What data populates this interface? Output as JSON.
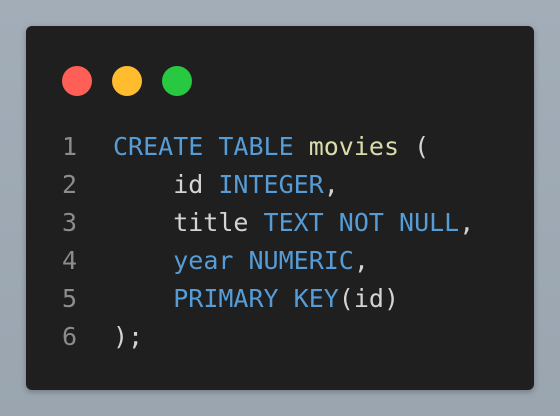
{
  "colors": {
    "background": "#9fa9b4",
    "window": "#1f1f1f",
    "dot_red": "#ff5f57",
    "dot_yellow": "#febc2e",
    "dot_green": "#28c840",
    "keyword": "#569cd6",
    "identifier_highlight": "#dcdcaa",
    "text": "#d4d4d4",
    "line_number": "#8c8c8c"
  },
  "window_controls": [
    {
      "name": "close-dot",
      "color": "#ff5f57"
    },
    {
      "name": "minimize-dot",
      "color": "#febc2e"
    },
    {
      "name": "maximize-dot",
      "color": "#28c840"
    }
  ],
  "code_lines": [
    {
      "number": "1",
      "tokens": [
        {
          "type": "kw",
          "text": "CREATE"
        },
        {
          "type": "plain",
          "text": " "
        },
        {
          "type": "kw",
          "text": "TABLE"
        },
        {
          "type": "plain",
          "text": " "
        },
        {
          "type": "name",
          "text": "movies"
        },
        {
          "type": "plain",
          "text": " ("
        }
      ]
    },
    {
      "number": "2",
      "tokens": [
        {
          "type": "plain",
          "text": "    id "
        },
        {
          "type": "kw",
          "text": "INTEGER"
        },
        {
          "type": "plain",
          "text": ","
        }
      ]
    },
    {
      "number": "3",
      "tokens": [
        {
          "type": "plain",
          "text": "    title "
        },
        {
          "type": "kw",
          "text": "TEXT"
        },
        {
          "type": "plain",
          "text": " "
        },
        {
          "type": "kw",
          "text": "NOT"
        },
        {
          "type": "plain",
          "text": " "
        },
        {
          "type": "kw",
          "text": "NULL"
        },
        {
          "type": "plain",
          "text": ","
        }
      ]
    },
    {
      "number": "4",
      "tokens": [
        {
          "type": "plain",
          "text": "    "
        },
        {
          "type": "kw",
          "text": "year"
        },
        {
          "type": "plain",
          "text": " "
        },
        {
          "type": "kw",
          "text": "NUMERIC"
        },
        {
          "type": "plain",
          "text": ","
        }
      ]
    },
    {
      "number": "5",
      "tokens": [
        {
          "type": "plain",
          "text": "    "
        },
        {
          "type": "kw",
          "text": "PRIMARY"
        },
        {
          "type": "plain",
          "text": " "
        },
        {
          "type": "kw",
          "text": "KEY"
        },
        {
          "type": "plain",
          "text": "(id)"
        }
      ]
    },
    {
      "number": "6",
      "tokens": [
        {
          "type": "plain",
          "text": ");"
        }
      ]
    }
  ]
}
